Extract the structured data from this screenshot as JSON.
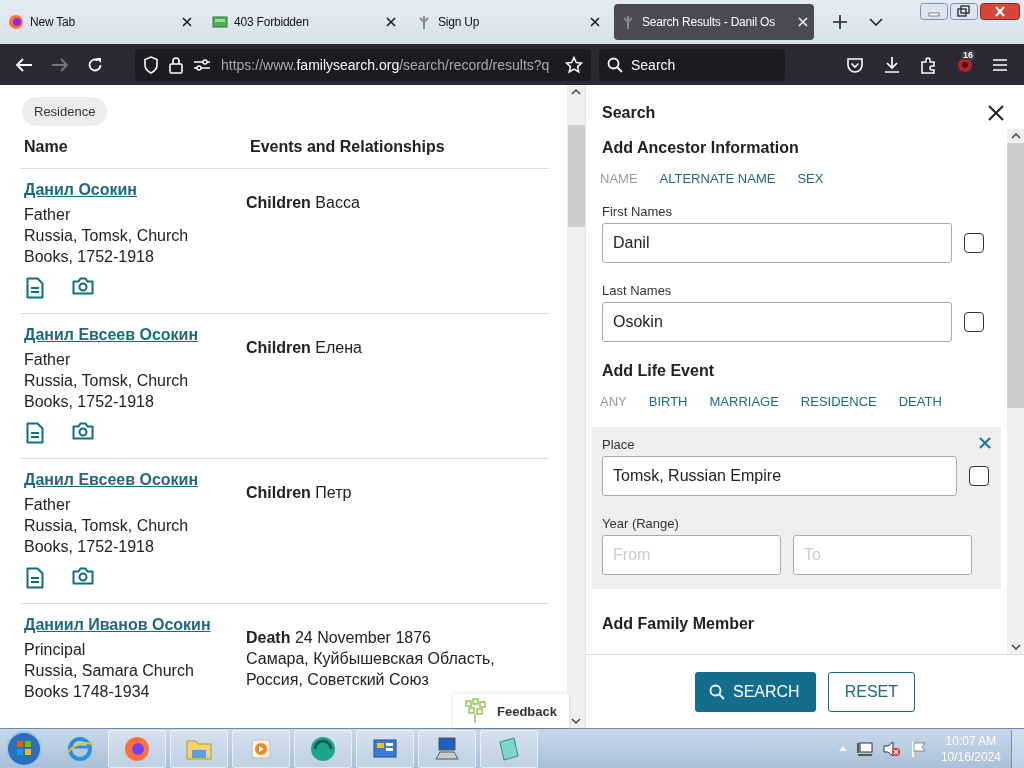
{
  "browser": {
    "tabs": [
      {
        "title": "New Tab",
        "selected": false
      },
      {
        "title": "403 Forbidden",
        "selected": false
      },
      {
        "title": "Sign Up",
        "selected": false
      },
      {
        "title": "Search Results - Danil Os",
        "selected": true
      }
    ],
    "url": {
      "prefix": "https://www.",
      "domain": "familysearch.org",
      "path": "/search/record/results?q"
    },
    "search_placeholder": "Search",
    "extension_badge": "16"
  },
  "results": {
    "filter_chip": "Residence",
    "columns": [
      "Name",
      "Events and Relationships"
    ],
    "rows": [
      {
        "name": "Данил Осокин",
        "role": "Father",
        "collection": "Russia, Tomsk, Church Books, 1752-1918",
        "has_actions": true,
        "events": [
          {
            "text": "**Children** Васса"
          }
        ]
      },
      {
        "name": "Данил Евсеев Осокин",
        "role": "Father",
        "collection": "Russia, Tomsk, Church Books, 1752-1918",
        "has_actions": true,
        "events": [
          {
            "text": "**Children** Елена"
          }
        ]
      },
      {
        "name": "Данил Евсеев Осокин",
        "role": "Father",
        "collection": "Russia, Tomsk, Church Books, 1752-1918",
        "has_actions": true,
        "events": [
          {
            "text": "**Children** Петр"
          }
        ]
      },
      {
        "name": "Даниил Иванов Осокин",
        "role": "Principal",
        "collection": "Russia, Samara Church Books 1748-1934",
        "has_actions": false,
        "events": [
          {
            "text": "**Death**  24 November 1876",
            "detail": "Самара, Куйбышевская Область, Россия, Советский Союз"
          }
        ]
      }
    ],
    "feedback": "Feedback"
  },
  "search_panel": {
    "title": "Search",
    "ancestor": {
      "heading": "Add Ancestor Information",
      "tabs": [
        {
          "label": "NAME",
          "selected": true
        },
        {
          "label": "ALTERNATE NAME",
          "selected": false
        },
        {
          "label": "SEX",
          "selected": false
        }
      ],
      "fields": [
        {
          "label": "First Names",
          "value": "Danil",
          "checked": false
        },
        {
          "label": "Last Names",
          "value": "Osokin",
          "checked": false
        }
      ]
    },
    "life_event": {
      "heading": "Add Life Event",
      "tabs": [
        {
          "label": "ANY",
          "selected": true
        },
        {
          "label": "BIRTH",
          "selected": false
        },
        {
          "label": "MARRIAGE",
          "selected": false
        },
        {
          "label": "RESIDENCE",
          "selected": false
        },
        {
          "label": "DEATH",
          "selected": false
        }
      ],
      "place": {
        "label": "Place",
        "value": "Tomsk, Russian Empire",
        "checked": false
      },
      "year": {
        "label": "Year (Range)",
        "from_placeholder": "From",
        "to_placeholder": "To"
      }
    },
    "family_heading": "Add Family Member",
    "search_button": "SEARCH",
    "reset_button": "RESET"
  },
  "taskbar": {
    "time": "10:07 AM",
    "date": "10/16/2024"
  }
}
